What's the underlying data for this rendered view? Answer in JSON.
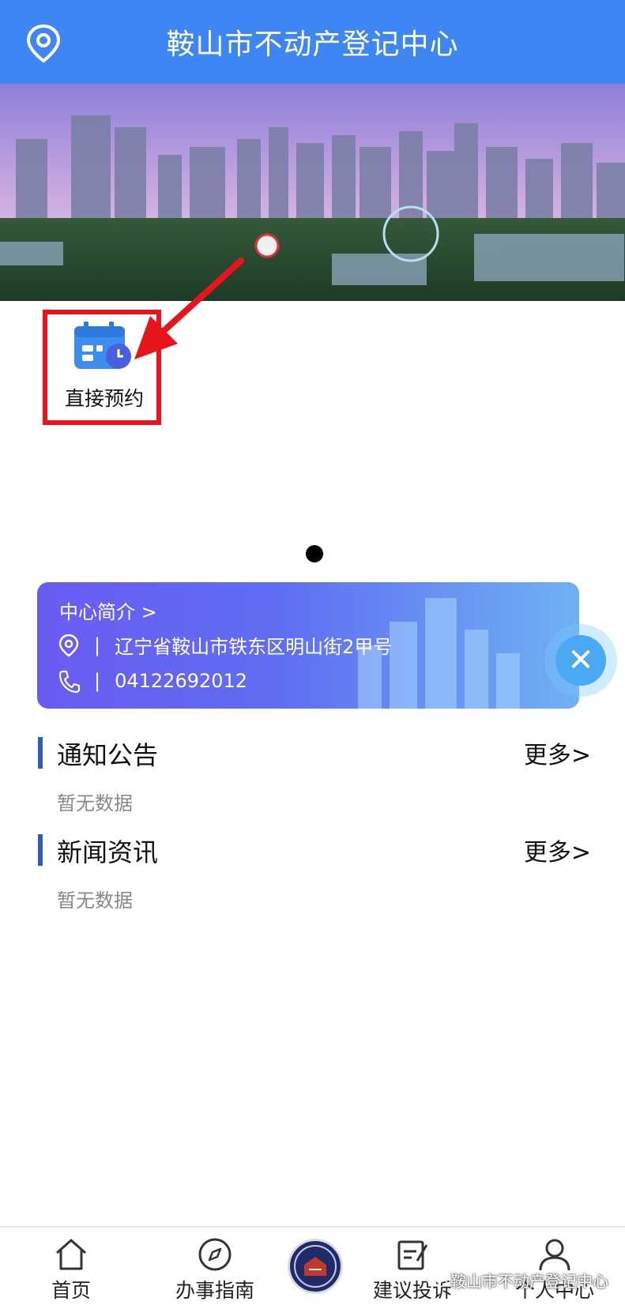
{
  "header": {
    "title": "鞍山市不动产登记中心",
    "icon": "location-pin-icon"
  },
  "apps": [
    {
      "label": "直接预约",
      "icon": "calendar-clock-icon"
    }
  ],
  "carousel": {
    "active_index": 0,
    "total": 1
  },
  "intro": {
    "title": "中心简介 >",
    "address": "辽宁省鞍山市铁东区明山街2甲号",
    "phone": "04122692012",
    "separator": "|"
  },
  "sections": [
    {
      "title": "通知公告",
      "more": "更多>",
      "empty": "暂无数据"
    },
    {
      "title": "新闻资讯",
      "more": "更多>",
      "empty": "暂无数据"
    }
  ],
  "tabbar": {
    "items": [
      {
        "label": "首页",
        "icon": "home-icon"
      },
      {
        "label": "办事指南",
        "icon": "compass-icon"
      },
      {
        "label": "",
        "icon": "emblem-logo"
      },
      {
        "label": "建议投诉",
        "icon": "edit-form-icon"
      },
      {
        "label": "个人中心",
        "icon": "person-icon"
      }
    ]
  },
  "watermark": "鞍山市不动产登记中心",
  "colors": {
    "header": "#3f86f5",
    "highlight": "#e8141b",
    "card_start": "#6a5bf3",
    "card_end": "#6fb1f3"
  }
}
